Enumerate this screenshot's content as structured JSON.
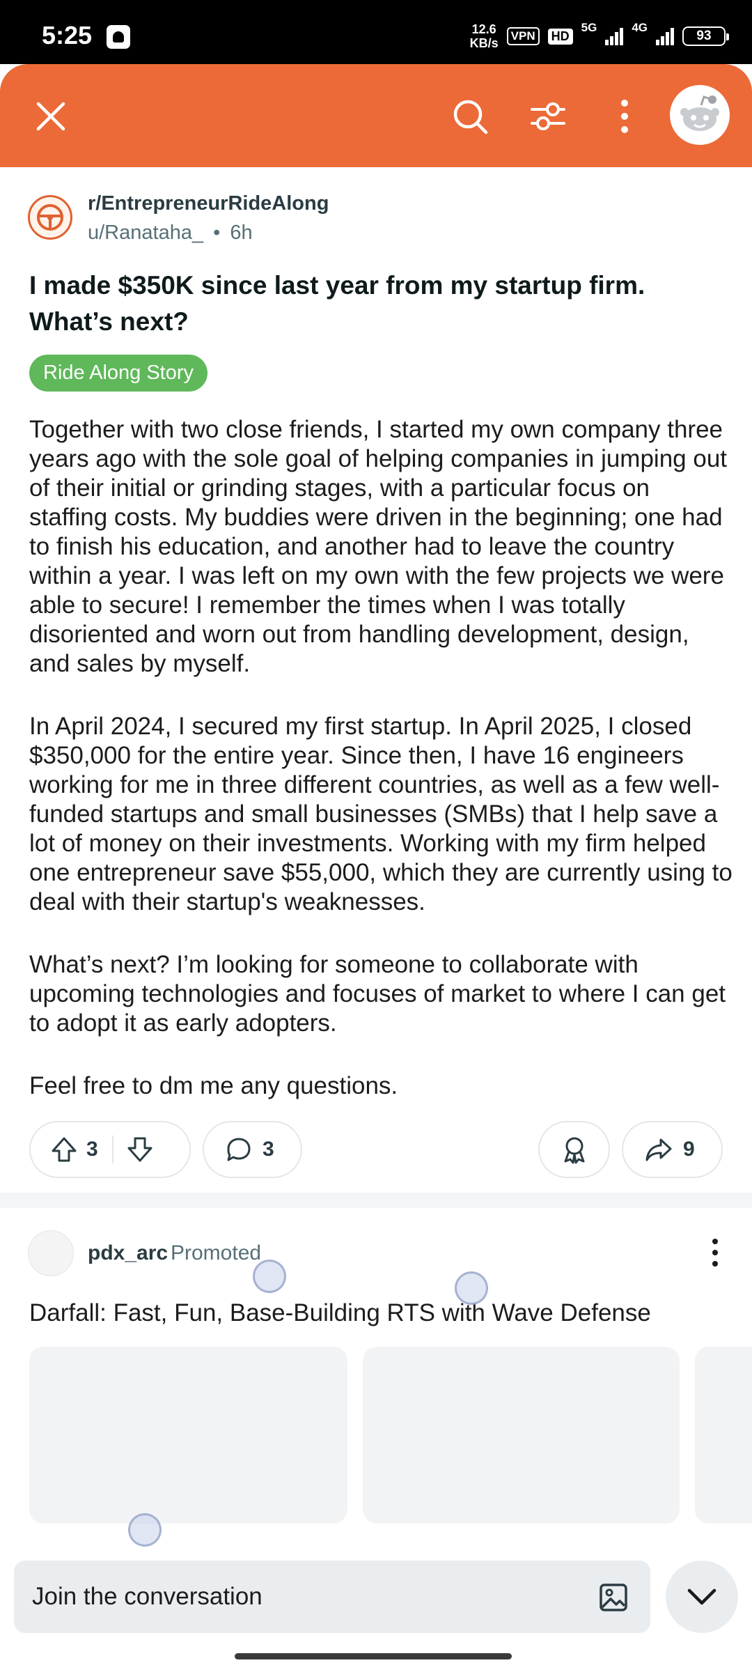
{
  "status_bar": {
    "time": "5:25",
    "net_speed_value": "12.6",
    "net_speed_unit": "KB/s",
    "vpn": "VPN",
    "hd": "HD",
    "net_type_1": "5G",
    "net_type_2": "4G",
    "battery": "93"
  },
  "header": {
    "close_icon": "close-icon",
    "search_icon": "search-icon",
    "filter_icon": "sort-filter-icon",
    "more_icon": "more-vertical-icon",
    "background_color": "#ec6a37"
  },
  "post": {
    "subreddit": "r/EntrepreneurRideAlong",
    "author": "u/Ranataha_",
    "separator": "•",
    "age": "6h",
    "title": "I made $350K since last year from my startup firm. What’s next?",
    "flair": "Ride Along Story",
    "flair_color": "#5fb85a",
    "body": [
      "Together with two close friends, I started my own company three years ago with the sole goal of helping companies in jumping out of their initial or grinding stages, with a particular focus on staffing costs. My buddies were driven in the beginning; one had to finish his education, and another had to leave the country within a year. I was left on my own with the few projects we were able to secure! I remember the times when I was totally disoriented and worn out from handling development, design, and sales by myself.",
      "In April 2024, I secured my first startup. In April 2025, I closed $350,000 for the entire year. Since then, I have 16 engineers working for me in three different countries, as well as a few well-funded startups and small businesses (SMBs) that I help save a lot of money on their investments. Working with my firm helped one entrepreneur save $55,000, which they are currently using to deal with their startup's weaknesses.",
      "What’s next? I’m looking for someone to collaborate with upcoming technologies and focuses of market to where I can get to adopt it as early adopters.",
      "Feel free to dm me any questions."
    ],
    "actions": {
      "upvotes": "3",
      "comments": "3",
      "shares": "9"
    }
  },
  "promoted": {
    "advertiser": "pdx_arc",
    "label": "Promoted",
    "title": "Darfall: Fast, Fun, Base-Building RTS with Wave Defense"
  },
  "bottom_bar": {
    "placeholder": "Join the conversation",
    "image_icon": "image-icon",
    "collapse_icon": "chevron-down-icon"
  }
}
